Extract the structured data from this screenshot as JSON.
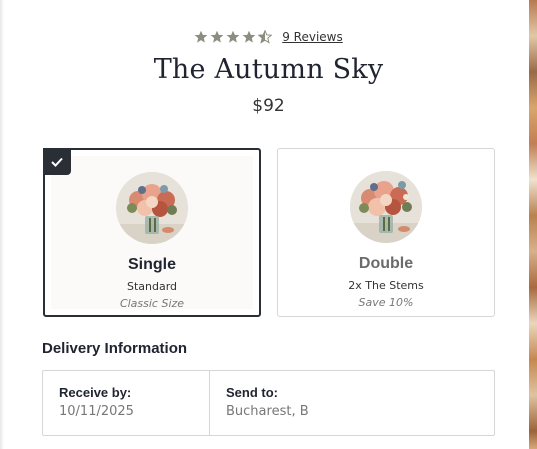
{
  "product": {
    "rating": 4.5,
    "reviews_label": "9 Reviews",
    "title": "The Autumn Sky",
    "price": "$92"
  },
  "options": [
    {
      "name": "Single",
      "subtitle": "Standard",
      "note": "Classic Size",
      "selected": true
    },
    {
      "name": "Double",
      "subtitle": "2x The Stems",
      "note": "Save 10%",
      "selected": false
    }
  ],
  "delivery": {
    "heading": "Delivery Information",
    "receive_label": "Receive by:",
    "receive_value": "10/11/2025",
    "send_label": "Send to:",
    "send_value": "Bucharest, B"
  },
  "colors": {
    "star": "#8c8c80",
    "accent_dark": "#2a2f36",
    "border": "#d6d6d6"
  },
  "icons": [
    "star-icon",
    "half-star-icon",
    "checkmark-icon",
    "bouquet-image"
  ]
}
